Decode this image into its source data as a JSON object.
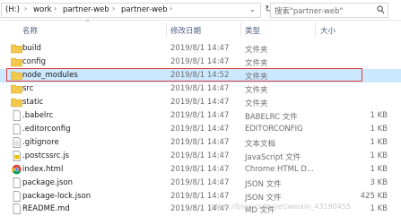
{
  "address_bar": {
    "crumbs": [
      "(H:)",
      "work",
      "partner-web",
      "partner-web"
    ],
    "search_placeholder": "搜索\"partner-web\""
  },
  "columns": {
    "name": "名称",
    "date": "修改日期",
    "type": "类型",
    "size": "大小"
  },
  "files": [
    {
      "name": "build",
      "date": "2019/8/1 14:47",
      "type": "文件夹",
      "size": "",
      "icon": "folder-icon"
    },
    {
      "name": "config",
      "date": "2019/8/1 14:47",
      "type": "文件夹",
      "size": "",
      "icon": "folder-icon"
    },
    {
      "name": "node_modules",
      "date": "2019/8/1 14:52",
      "type": "文件夹",
      "size": "",
      "icon": "folder-icon",
      "selected": true
    },
    {
      "name": "src",
      "date": "2019/8/1 14:47",
      "type": "文件夹",
      "size": "",
      "icon": "folder-icon"
    },
    {
      "name": "static",
      "date": "2019/8/1 14:47",
      "type": "文件夹",
      "size": "",
      "icon": "folder-icon"
    },
    {
      "name": ".babelrc",
      "date": "2019/8/1 14:47",
      "type": "BABELRC 文件",
      "size": "1 KB",
      "icon": "file-icon"
    },
    {
      "name": ".editorconfig",
      "date": "2019/8/1 14:47",
      "type": "EDITORCONFIG",
      "size": "1 KB",
      "icon": "file-icon"
    },
    {
      "name": ".gitignore",
      "date": "2019/8/1 14:47",
      "type": "文本文档",
      "size": "1 KB",
      "icon": "text-file-icon"
    },
    {
      "name": ".postcssrc.js",
      "date": "2019/8/1 14:47",
      "type": "JavaScript 文件",
      "size": "1 KB",
      "icon": "js-file-icon"
    },
    {
      "name": "index.html",
      "date": "2019/8/1 14:47",
      "type": "Chrome HTML D...",
      "size": "1 KB",
      "icon": "chrome-html-icon"
    },
    {
      "name": "package.json",
      "date": "2019/8/1 14:47",
      "type": "JSON 文件",
      "size": "3 KB",
      "icon": "file-icon"
    },
    {
      "name": "package-lock.json",
      "date": "2019/8/1 14:47",
      "type": "JSON 文件",
      "size": "425 KB",
      "icon": "file-icon"
    },
    {
      "name": "README.md",
      "date": "2019/8/1 14:47",
      "type": "MD 文件",
      "size": "1 KB",
      "icon": "file-icon"
    }
  ],
  "watermark": "https://blog.csdn.net/weixin_43190455"
}
